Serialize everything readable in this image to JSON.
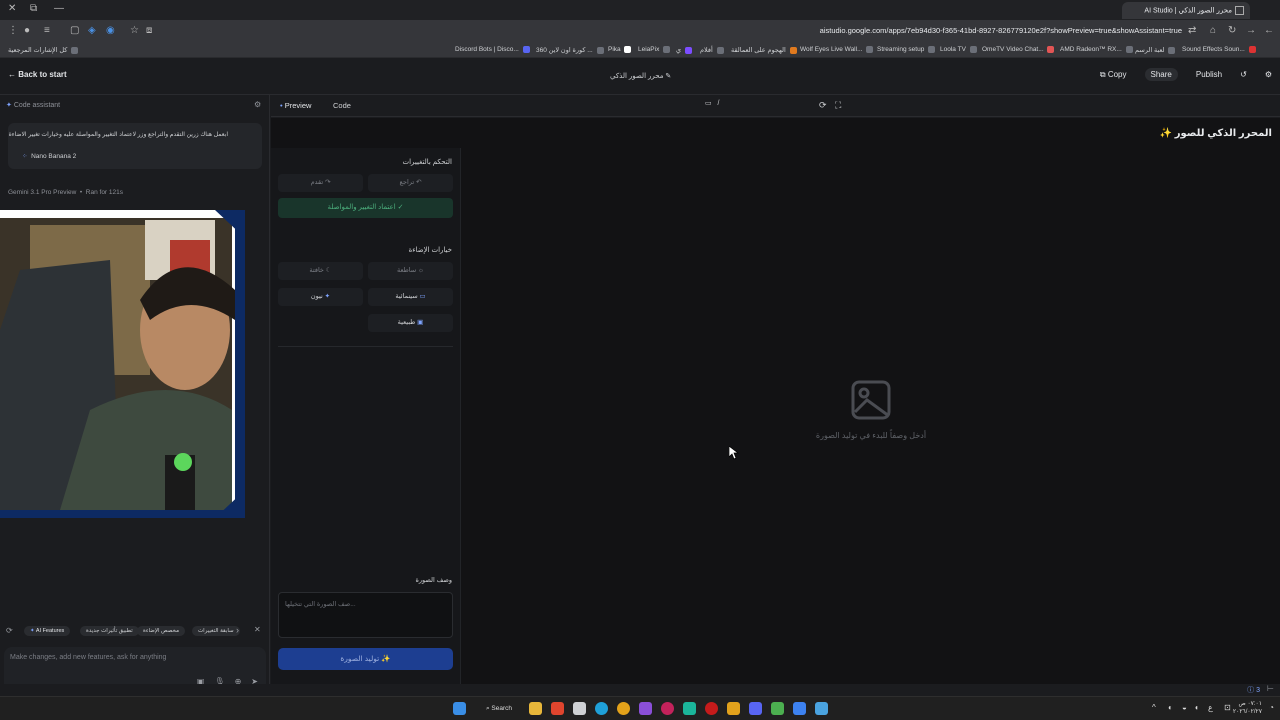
{
  "browser": {
    "tab_title": "محرر الصور الذكي | AI Studio",
    "url": "aistudio.google.com/apps/7eb94d30-f365-41bd-8927-826779120e2f?showPreview=true&showAssistant=true",
    "bookmarks": [
      "كل الإشارات المرجعية",
      "Discord Bots | Disco...",
      "360 كورة اون لاين ...",
      "Pika",
      "LeiaPix",
      "ي",
      "أفلام",
      "الهجوم على العمالقة",
      "Wolf Eyes Live Wall...",
      "Streaming setup",
      "Loola TV",
      "OmeTV Video Chat...",
      "AMD Radeon™ RX...",
      "لعبة الرسم",
      "Sound Effects Soun..."
    ]
  },
  "header": {
    "back_label": "Back to start",
    "app_title": "محرر الصور الذكي",
    "copy_label": "Copy",
    "share_label": "Share",
    "publish_label": "Publish"
  },
  "assistant": {
    "title": "Code assistant",
    "user_message": "ابعمل هناك زرين التقدم والتراجع وزر لاعتماد التغيير والمواصلة عليه وخيارات تغيير الاضاءة",
    "model_chip": "Nano Banana 2",
    "model_line": "Gemini 3.1 Pro Preview",
    "run_time": "Ran for 121s",
    "suggestions": [
      "سابقة التغييرات",
      "مخصص الإضاءة",
      "تطبيق تأثيرات جديدة",
      "AI Features"
    ],
    "input_placeholder": "Make changes, add new features, ask for anything"
  },
  "preview": {
    "tab_preview": "Preview",
    "tab_code": "Code",
    "route": "/"
  },
  "app": {
    "heading": "المحرر الذكي للصور",
    "changes_title": "التحكم بالتغييرات",
    "undo_label": "تراجع",
    "redo_label": "تقدم",
    "approve_label": "اعتماد التغيير والمواصلة",
    "lighting_title": "خيارات الإضاءة",
    "lighting_options": {
      "bright": "ساطعة",
      "dim": "خافتة",
      "cinematic": "سينمائية",
      "neon": "نيون",
      "natural": "طبيعية"
    },
    "empty_text": "أدخل وصفاً للبدء في توليد الصورة",
    "desc_label": "وصف الصورة",
    "desc_placeholder": "صف الصورة التي تتخيلها...",
    "generate_label": "توليد الصورة"
  },
  "status": {
    "notifications": "3"
  },
  "taskbar": {
    "search_label": "Search",
    "time": "٠٧:٠١ ص",
    "date": "٢٠٢٦/٠٢/٢٧"
  }
}
